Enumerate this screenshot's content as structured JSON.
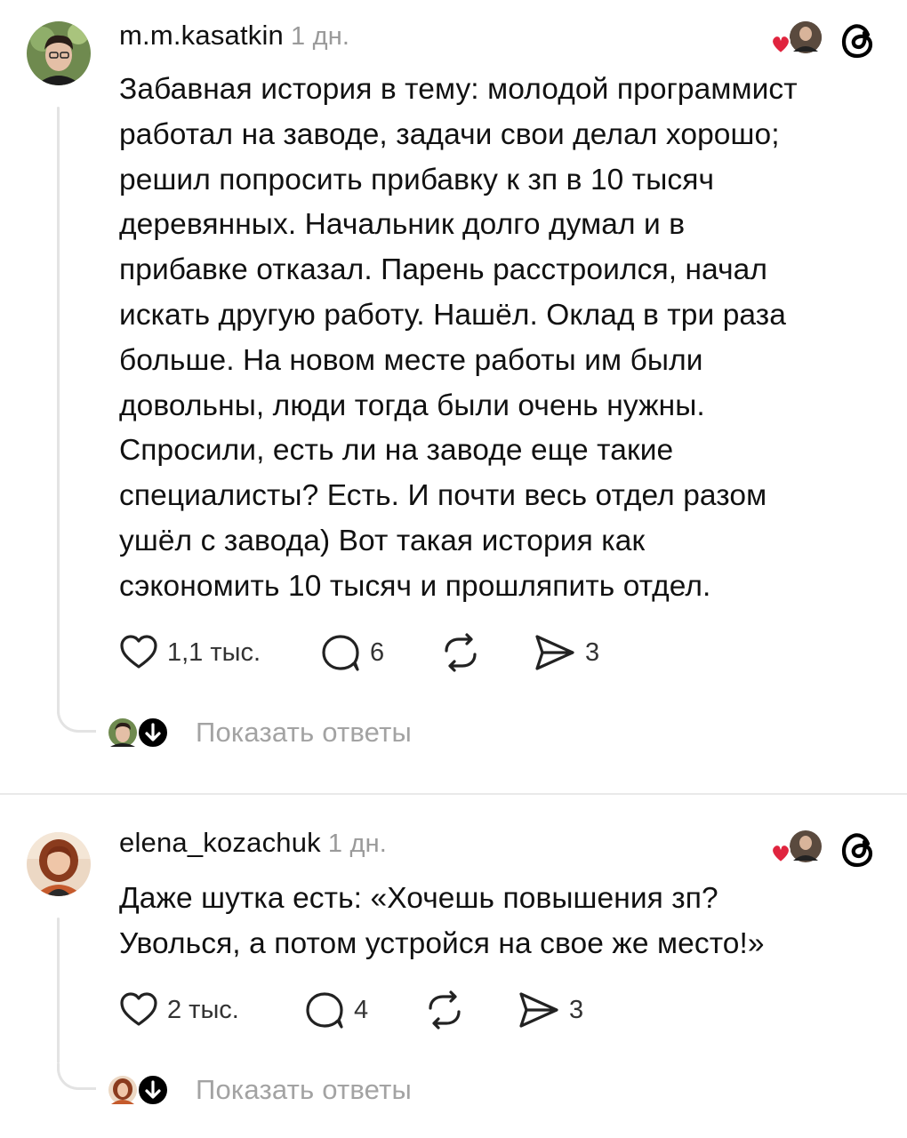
{
  "posts": [
    {
      "username": "m.m.kasatkin",
      "time": "1 дн.",
      "avatar_icon": "user-avatar-photo",
      "text": "Забавная история в тему: молодой программист\nработал на заводе, задачи свои делал хорошо;\nрешил попросить прибавку к зп в 10 тысяч\nдеревянных. Начальник долго думал и в\nприбавке отказал. Парень расстроился, начал\nискать другую работу. Нашёл. Оклад в три раза\nбольше. На новом месте работы им были\nдовольны, люди тогда были очень нужны.\nСпросили, есть ли на заводе еще такие\nспециалисты? Есть. И почти весь отдел разом\nушёл с завода) Вот такая история как\nсэкономить 10 тысяч и прошляпить отдел.",
      "likes": "1,1 тыс.",
      "comments": "6",
      "shares": "3",
      "replies_label": "Показать ответы"
    },
    {
      "username": "elena_kozachuk",
      "time": "1 дн.",
      "avatar_icon": "user-avatar-photo",
      "text": "Даже шутка есть: «Хочешь повышения зп?\nУволься, а потом устройся на свое же место!»",
      "likes": "2 тыс.",
      "comments": "4",
      "shares": "3",
      "replies_label": "Показать ответы"
    }
  ],
  "colors": {
    "heart_red": "#e0243e",
    "muted_text": "#9a9a9a",
    "thread_line": "#e3e3e3"
  }
}
